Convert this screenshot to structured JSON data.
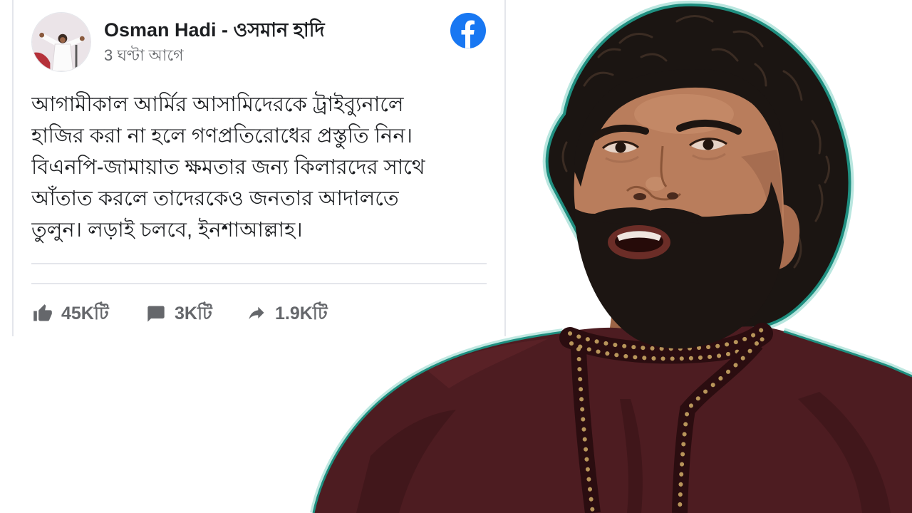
{
  "post": {
    "author_name": "Osman Hadi - ওসমান হাদি",
    "timestamp": "3 ঘণ্টা আগে",
    "text_lines": [
      "আগামীকাল আর্মির আসামিদেরকে ট্রাইব্যুনালে",
      "হাজির করা না হলে গণপ্রতিরোধের প্রস্তুতি নিন।",
      "বিএনপি-জামায়াত ক্ষমতার জন্য কিলারদের সাথে",
      "আঁতাত করলে তাদেরকেও জনতার আদালতে",
      "তুলুন। লড়াই চলবে, ইনশাআল্লাহ।"
    ],
    "stats": {
      "likes": "45Kটি",
      "comments": "3Kটি",
      "shares": "1.9Kটি"
    }
  },
  "icons": {
    "avatar": "profile-photo-avatar",
    "platform": "facebook-icon",
    "likes": "thumbs-up-icon",
    "comments": "comment-icon",
    "shares": "share-arrow-icon"
  },
  "colors": {
    "facebook_blue": "#1877f2",
    "text_primary": "#1c1e21",
    "text_secondary": "#65676b",
    "card_border": "#e4e6eb",
    "kurta_maroon": "#4d1c21",
    "collar_trim": "#b8955a",
    "cutout_outline": "#1f8f80"
  }
}
